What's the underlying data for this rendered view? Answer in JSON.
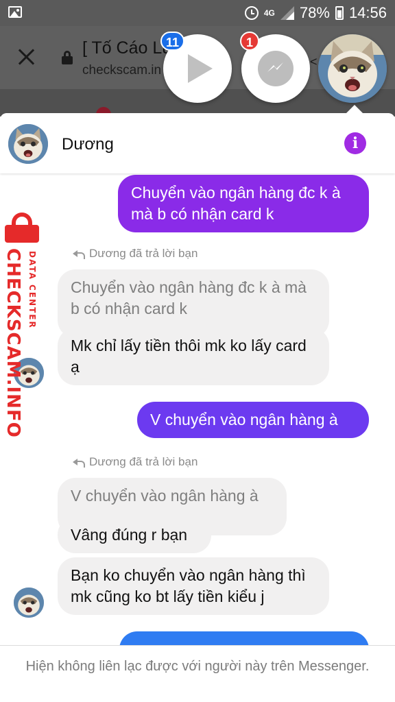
{
  "status_bar": {
    "network": "4G",
    "battery": "78%",
    "time": "14:56"
  },
  "browser": {
    "title": "[ Tố Cáo Lừ",
    "url": "checkscam.in"
  },
  "chat_heads": {
    "video_badge": "11",
    "messenger_badge": "1"
  },
  "conversation": {
    "contact_name": "Dương",
    "messages": [
      {
        "type": "outgoing",
        "text": "Chuyển vào ngân hàng đc k à mà b có nhận card k",
        "color": "#8a2be8"
      },
      {
        "type": "reply_label",
        "text": "Dương đã trả lời bạn"
      },
      {
        "type": "quote",
        "text": "Chuyển vào ngân hàng đc k à mà b có nhận card k"
      },
      {
        "type": "incoming",
        "text": "Mk chỉ lấy tiền thôi mk ko lấy card ạ"
      },
      {
        "type": "outgoing",
        "text": "V chuyển vào ngân hàng à",
        "color": "#6c3af0"
      },
      {
        "type": "reply_label",
        "text": "Dương đã trả lời bạn"
      },
      {
        "type": "quote",
        "text": "V chuyển vào ngân hàng à"
      },
      {
        "type": "incoming",
        "text": "Vâng đúng r bạn"
      },
      {
        "type": "incoming",
        "text": "Bạn ko chuyển vào ngân hàng thì mk cũng ko bt lấy tiền kiểu j"
      },
      {
        "type": "outgoing",
        "text": "",
        "color": "#2f7cf2"
      }
    ]
  },
  "watermark": {
    "brand": "CHECKSCAM.INFO",
    "tagline": "DATA CENTER"
  },
  "footer": {
    "notice": "Hiện không liên lạc được với người này trên Messenger."
  },
  "colors": {
    "accent_purple": "#a02be3",
    "watermark_red": "#e52a2a"
  }
}
